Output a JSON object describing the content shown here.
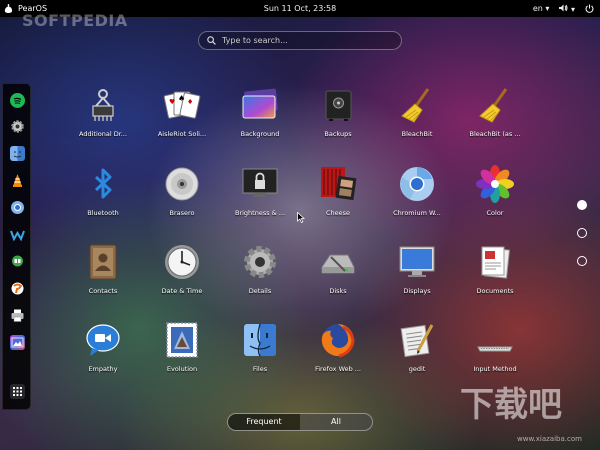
{
  "topbar": {
    "os_name": "PearOS",
    "clock": "Sun 11 Oct, 23:58",
    "language": "en",
    "language_chevron": "▾",
    "volume_chevron": "▾"
  },
  "watermark": {
    "brand": "SOFTPEDIA",
    "logo_text": "下载吧",
    "url": "www.xiazaiba.com"
  },
  "search": {
    "placeholder": "Type to search..."
  },
  "dock": {
    "items": [
      "spotify-icon",
      "gear-icon",
      "finder-icon",
      "vlc-icon",
      "chrome-icon",
      "w-icon",
      "hangouts-icon",
      "pidgin-icon",
      "printer-icon",
      "photos-icon",
      "apps-grid-icon"
    ]
  },
  "apps": [
    {
      "label": "Additional Dr...",
      "icon": "chip-icon"
    },
    {
      "label": "AisleRiot Soli...",
      "icon": "cards-icon"
    },
    {
      "label": "Background",
      "icon": "background-icon"
    },
    {
      "label": "Backups",
      "icon": "safe-icon"
    },
    {
      "label": "BleachBit",
      "icon": "broom-icon"
    },
    {
      "label": "BleachBit (as ...",
      "icon": "broom-icon"
    },
    {
      "label": "Bluetooth",
      "icon": "bluetooth-icon"
    },
    {
      "label": "Brasero",
      "icon": "disc-icon"
    },
    {
      "label": "Brightness & ...",
      "icon": "lock-screen-icon"
    },
    {
      "label": "Cheese",
      "icon": "cheese-icon"
    },
    {
      "label": "Chromium W...",
      "icon": "chromium-icon"
    },
    {
      "label": "Color",
      "icon": "color-icon"
    },
    {
      "label": "Contacts",
      "icon": "contacts-icon"
    },
    {
      "label": "Date & Time",
      "icon": "clock-icon"
    },
    {
      "label": "Details",
      "icon": "gear-icon"
    },
    {
      "label": "Disks",
      "icon": "disk-icon"
    },
    {
      "label": "Displays",
      "icon": "display-icon"
    },
    {
      "label": "Documents",
      "icon": "documents-icon"
    },
    {
      "label": "Empathy",
      "icon": "chat-icon"
    },
    {
      "label": "Evolution",
      "icon": "stamp-icon"
    },
    {
      "label": "Files",
      "icon": "finder-icon"
    },
    {
      "label": "Firefox Web ...",
      "icon": "firefox-icon"
    },
    {
      "label": "gedit",
      "icon": "text-editor-icon"
    },
    {
      "label": "Input Method",
      "icon": "keyboard-icon"
    }
  ],
  "pager": {
    "pages": 3,
    "active_index": 0
  },
  "view_toggle": {
    "frequent_label": "Frequent",
    "all_label": "All",
    "selected": "All"
  },
  "colors": {
    "topbar": "#000000",
    "dock": "#000000",
    "text": "#ffffff"
  }
}
